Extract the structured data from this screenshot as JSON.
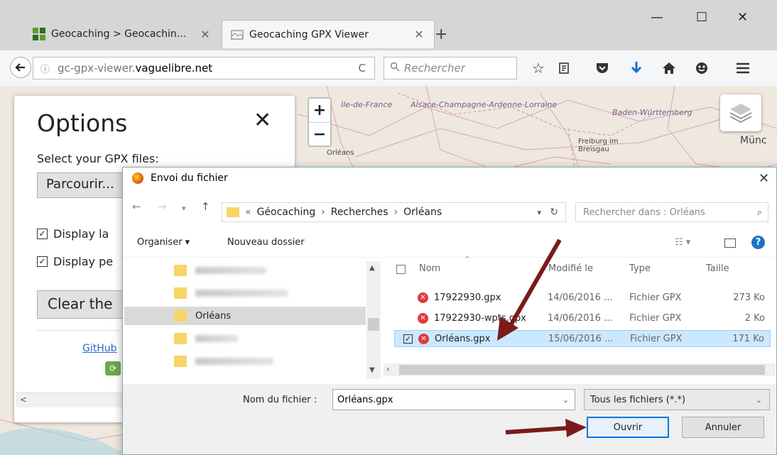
{
  "browser": {
    "tabs": [
      {
        "title": "Geocaching > Geocachin...",
        "close": "✕"
      },
      {
        "title": "Geocaching GPX Viewer",
        "close": "✕"
      }
    ],
    "new_tab": "+",
    "window_controls": {
      "minimize": "—",
      "maximize": "☐",
      "close": "✕"
    },
    "url_prefix": "gc-gpx-viewer.",
    "url_host": "vaguelibre.net",
    "reload": "C",
    "search_placeholder": "Rechercher"
  },
  "map": {
    "labels": [
      "Ile-de-France",
      "Alsace-Champagne-Ardenne-Lorraine",
      "Baden-Württemberg",
      "Orléans",
      "Freiburg im Breisgau",
      "Münc"
    ],
    "zoom_in": "+",
    "zoom_out": "−"
  },
  "options": {
    "title": "Options",
    "close": "✕",
    "select_label": "Select your GPX files:",
    "browse_button": "Parcourir...",
    "checkboxes": [
      {
        "label": "Display la",
        "checked": true
      },
      {
        "label": "Display pe",
        "checked": true
      }
    ],
    "clear_button": "Clear the",
    "github_link": "GitHub",
    "scroll_left": "<"
  },
  "dialog": {
    "title": "Envoi du fichier",
    "close": "✕",
    "breadcrumb": [
      "«",
      "Géocaching",
      "Recherches",
      "Orléans"
    ],
    "search_placeholder": "Rechercher dans : Orléans",
    "organize": "Organiser ▾",
    "new_folder": "Nouveau dossier",
    "help": "?",
    "nav_selected": "Orléans",
    "columns": {
      "name": "Nom",
      "modified": "Modifié le",
      "type": "Type",
      "size": "Taille"
    },
    "files": [
      {
        "name": "17922930.gpx",
        "modified": "14/06/2016 ...",
        "type": "Fichier GPX",
        "size": "273 Ko",
        "selected": false
      },
      {
        "name": "17922930-wpts.gpx",
        "modified": "14/06/2016 ...",
        "type": "Fichier GPX",
        "size": "2 Ko",
        "selected": false
      },
      {
        "name": "Orléans.gpx",
        "modified": "15/06/2016 ...",
        "type": "Fichier GPX",
        "size": "171 Ko",
        "selected": true
      }
    ],
    "filename_label": "Nom du fichier :",
    "filename_value": "Orléans.gpx",
    "filetype": "Tous les fichiers (*.*)",
    "open_button": "Ouvrir",
    "cancel_button": "Annuler"
  },
  "colors": {
    "arrow": "#7a1b1b",
    "accent": "#0078d7",
    "selection": "#cce8ff"
  }
}
